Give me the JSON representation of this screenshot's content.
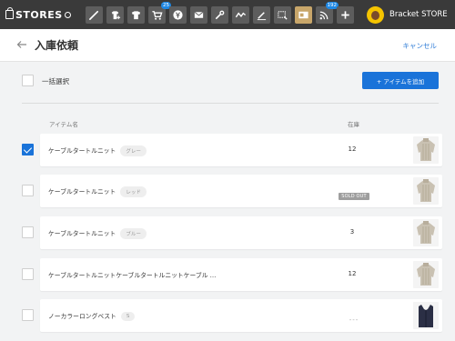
{
  "topbar": {
    "logo_text": "STORES",
    "tools": [
      {
        "icon": "pen-icon",
        "active": false
      },
      {
        "icon": "tshirt-add-icon",
        "active": false
      },
      {
        "icon": "tshirt-icon",
        "active": false
      },
      {
        "icon": "cart-icon",
        "active": false,
        "badge": "25"
      },
      {
        "icon": "yen-icon",
        "active": false
      },
      {
        "icon": "mail-icon",
        "active": false
      },
      {
        "icon": "wrench-icon",
        "active": false
      },
      {
        "icon": "graph-icon",
        "active": false
      },
      {
        "icon": "edit-icon",
        "active": false
      },
      {
        "icon": "crop-icon",
        "active": false
      },
      {
        "icon": "warehouse-icon",
        "active": true
      },
      {
        "icon": "rss-icon",
        "active": false,
        "badge": "192"
      },
      {
        "icon": "plus-icon",
        "active": false
      }
    ],
    "store_name": "Bracket STORE"
  },
  "header": {
    "title": "入庫依頼",
    "cancel_label": "キャンセル"
  },
  "controls": {
    "select_all_label": "一括選択",
    "add_item_label": "+ アイテムを追加"
  },
  "columns": {
    "name": "アイテム名",
    "stock": "在庫"
  },
  "items": [
    {
      "name": "ケーブルタートルニット",
      "variant": "グレー",
      "stock": "12",
      "checked": true,
      "thumb": "sweater"
    },
    {
      "name": "ケーブルタートルニット",
      "variant": "レッド",
      "stock": "SOLD OUT",
      "checked": false,
      "thumb": "sweater"
    },
    {
      "name": "ケーブルタートルニット",
      "variant": "ブルー",
      "stock": "3",
      "checked": false,
      "thumb": "sweater"
    },
    {
      "name": "ケーブルタートルニットケーブルタートルニットケーブル …",
      "variant": "",
      "stock": "12",
      "checked": false,
      "thumb": "sweater"
    },
    {
      "name": "ノーカラーロングベスト",
      "variant": "S",
      "stock": "---",
      "checked": false,
      "thumb": "vest"
    }
  ]
}
